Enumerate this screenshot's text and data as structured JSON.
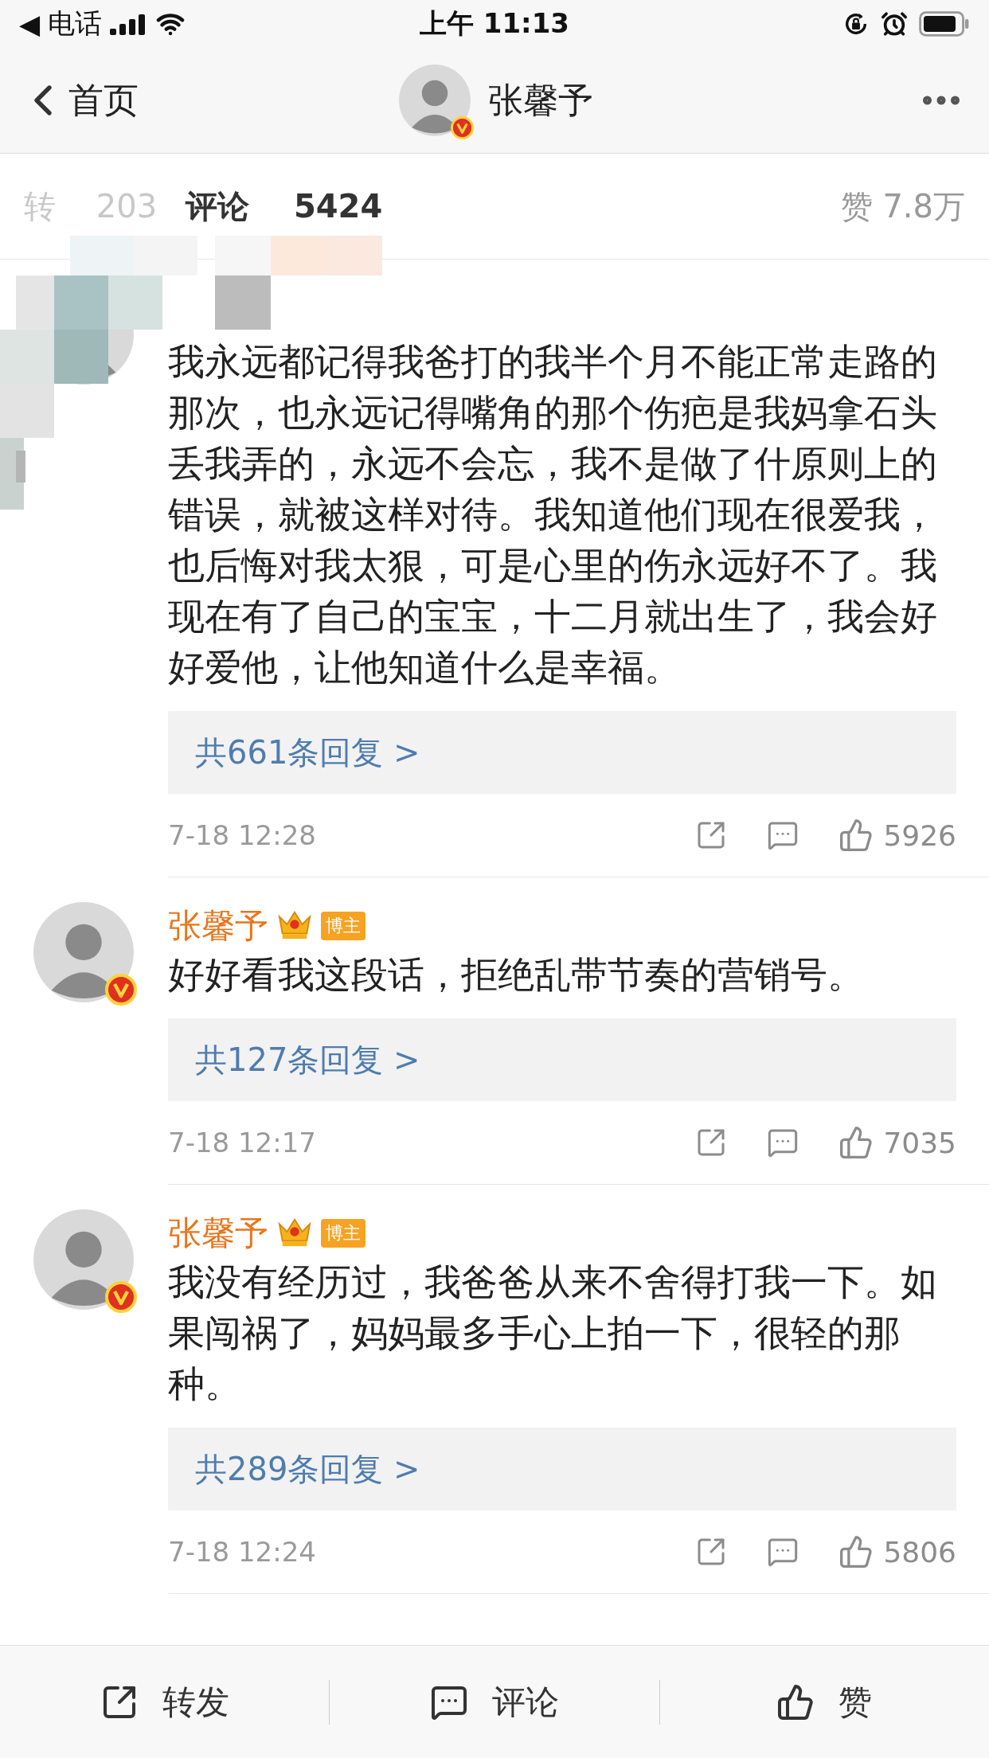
{
  "status_bar": {
    "back_arrow": "◀",
    "carrier": "电话",
    "time": "上午 11:13"
  },
  "nav": {
    "back_label": "首页",
    "title": "张馨予",
    "verified": true
  },
  "tabs": [
    {
      "label": "转",
      "count": "203",
      "selected": false
    },
    {
      "label": "评论",
      "count": "5424",
      "selected": true
    }
  ],
  "likes_label": "赞 7.8万",
  "comments": [
    {
      "text": "我永远都记得我爸打的我半个月不能正常走路的那次，也永远记得嘴角的那个伤疤是我妈拿石头丢我弄的，永远不会忘，我不是做了什原则上的错误，就被这样对待。我知道他们现在很爱我，也后悔对我太狠，可是心里的伤永远好不了。我现在有了自己的宝宝，十二月就出生了，我会好好爱他，让他知道什么是幸福。",
      "replies": "共661条回复 >",
      "time": "7-18 12:28",
      "like_count": "5926"
    },
    {
      "author": "张馨予",
      "verified": true,
      "crown": true,
      "badge": "博主",
      "text": "好好看我这段话，拒绝乱带节奏的营销号。",
      "replies": "共127条回复 >",
      "time": "7-18 12:17",
      "like_count": "7035"
    },
    {
      "author": "张馨予",
      "verified": true,
      "crown": true,
      "badge": "博主",
      "text": "我没有经历过，我爸爸从来不舍得打我一下。如果闯祸了，妈妈最多手心上拍一下，很轻的那种。",
      "replies": "共289条回复 >",
      "time": "7-18 12:24",
      "like_count": "5806"
    }
  ],
  "actions": [
    {
      "kind": "repost",
      "label": "转发"
    },
    {
      "kind": "comment",
      "label": "评论"
    },
    {
      "kind": "like",
      "label": "赞"
    }
  ]
}
